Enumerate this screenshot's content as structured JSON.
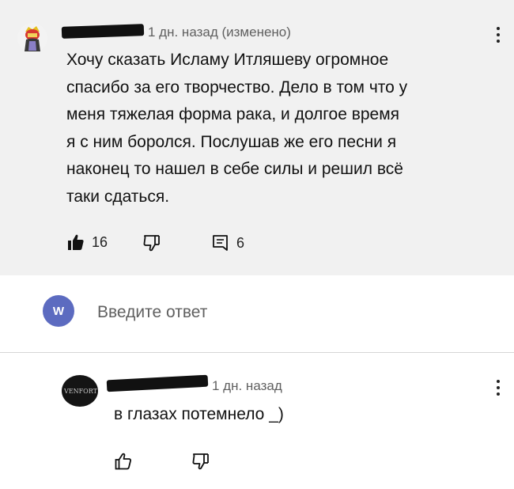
{
  "comment": {
    "timestamp": "1 дн. назад (изменено)",
    "text_lines": [
      "Хочу сказать Исламу Итляшеву огромное",
      "спасибо за его творчество. Дело в том что у",
      "меня тяжелая форма рака, и долгое время",
      "я с ним боролся. Послушав же его песни я",
      "наконец то нашел в себе силы и решил всё",
      "таки сдаться."
    ],
    "likes": "16",
    "replies": "6",
    "icons": {
      "menu": "more-vert-icon",
      "like": "thumb-up-filled-icon",
      "dislike": "thumb-down-icon",
      "reply": "comment-icon"
    }
  },
  "reply_box": {
    "avatar_letter": "W",
    "placeholder": "Введите ответ",
    "avatar_color": "#5c6bc0"
  },
  "reply": {
    "avatar_text": "VENFORT",
    "timestamp": "1 дн. назад",
    "text": "в глазах потемнело _)",
    "icons": {
      "menu": "more-vert-icon",
      "like": "thumb-up-icon",
      "dislike": "thumb-down-icon"
    }
  }
}
